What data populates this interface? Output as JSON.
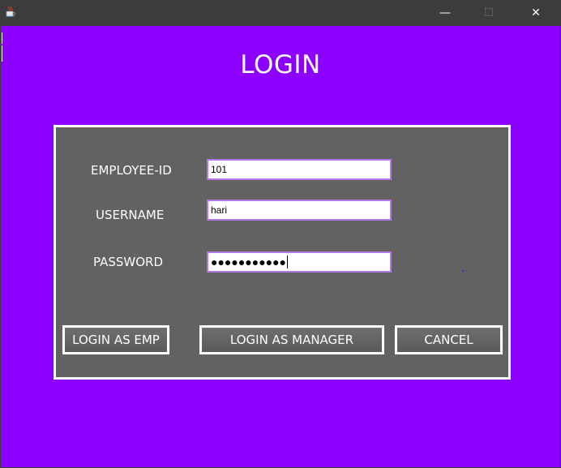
{
  "titlebar": {
    "app_icon": "java-cup-icon",
    "minimize_glyph": "—",
    "maximize_glyph": "☐",
    "close_glyph": "✕"
  },
  "form": {
    "title": "LOGIN",
    "employee_id_label": "EMPLOYEE-ID",
    "employee_id_value": "101",
    "username_label": "USERNAME",
    "username_value": "hari",
    "password_label": "PASSWORD",
    "password_masked": "●●●●●●●●●●●"
  },
  "buttons": {
    "login_emp": "LOGIN AS EMP",
    "login_manager": "LOGIN AS MANAGER",
    "cancel": "CANCEL"
  },
  "colors": {
    "background": "#8b00ff",
    "panel": "#626262",
    "titlebar": "#3c3c3c",
    "input_border": "#b478e6"
  }
}
